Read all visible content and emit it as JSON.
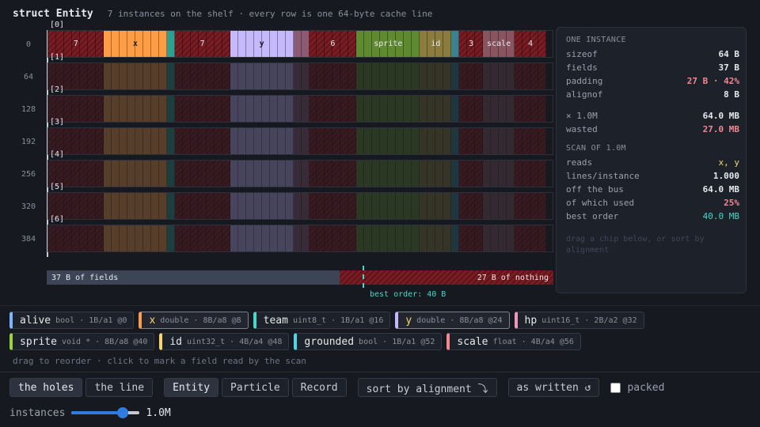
{
  "header": {
    "title": "struct Entity",
    "subtitle": "7 instances on the shelf · every row is one 64-byte cache line"
  },
  "fields": [
    {
      "id": "pad0",
      "hole": true,
      "label": "7",
      "bytes": 7
    },
    {
      "id": "x",
      "label": "x",
      "bytes": 8,
      "color": "#ff9d45"
    },
    {
      "id": "team",
      "label": "",
      "bytes": 1,
      "color": "#2fa08f"
    },
    {
      "id": "pad1",
      "hole": true,
      "label": "7",
      "bytes": 7
    },
    {
      "id": "y",
      "label": "y",
      "bytes": 8,
      "color": "#c5b8fb"
    },
    {
      "id": "hp",
      "label": "",
      "bytes": 2,
      "color": "#8c5a72"
    },
    {
      "id": "pad2",
      "hole": true,
      "label": "6",
      "bytes": 6
    },
    {
      "id": "sprite",
      "label": "sprite",
      "bytes": 8,
      "color": "#5f8a30"
    },
    {
      "id": "id",
      "label": "id",
      "bytes": 4,
      "color": "#8b7b3c"
    },
    {
      "id": "grounded",
      "label": "",
      "bytes": 1,
      "color": "#3c8190"
    },
    {
      "id": "pad3",
      "hole": true,
      "label": "3",
      "bytes": 3
    },
    {
      "id": "scale",
      "label": "scale",
      "bytes": 4,
      "color": "#87545f"
    },
    {
      "id": "pad4",
      "hole": true,
      "label": "4",
      "bytes": 4
    }
  ],
  "rows": [
    {
      "label": "[0]",
      "offset": "0",
      "active": true
    },
    {
      "label": "[1]",
      "offset": "64",
      "active": false
    },
    {
      "label": "[2]",
      "offset": "128",
      "active": false
    },
    {
      "label": "[3]",
      "offset": "192",
      "active": false
    },
    {
      "label": "[4]",
      "offset": "256",
      "active": false
    },
    {
      "label": "[5]",
      "offset": "320",
      "active": false
    },
    {
      "label": "[6]",
      "offset": "384",
      "active": false
    }
  ],
  "summary": {
    "fields_label": "37 B of fields",
    "nothing_label": "27 B of nothing",
    "fields_bytes": 37,
    "nothing_bytes": 27,
    "best_label": "best order: 40 B",
    "best_bytes": 40
  },
  "panel": {
    "instance_header": "ONE INSTANCE",
    "sizeof_key": "sizeof",
    "sizeof_val": "64 B",
    "fields_key": "fields",
    "fields_val": "37 B",
    "padding_key": "padding",
    "padding_val": "27 B · 42%",
    "alignof_key": "alignof",
    "alignof_val": "8 B",
    "times_key": "× 1.0M",
    "times_val": "64.0 MB",
    "wasted_key": "wasted",
    "wasted_val": "27.0 MB",
    "scan_header": "SCAN OF 1.0M",
    "reads_key": "reads",
    "reads_val": "x, y",
    "lines_key": "lines/instance",
    "lines_val": "1.000",
    "bus_key": "off the bus",
    "bus_val": "64.0 MB",
    "used_key": "of which used",
    "used_val": "25%",
    "best_key": "best order",
    "best_val": "40.0 MB",
    "hint": "drag a chip below, or sort by alignment"
  },
  "chips": [
    {
      "name": "alive",
      "meta": "bool · 1B/a1 @0",
      "color": "#7fb3ff",
      "read": false
    },
    {
      "name": "x",
      "meta": "double · 8B/a8 @8",
      "color": "#ff9d45",
      "read": true
    },
    {
      "name": "team",
      "meta": "uint8_t · 1B/a1 @16",
      "color": "#4ad6c4",
      "read": false
    },
    {
      "name": "y",
      "meta": "double · 8B/a8 @24",
      "color": "#c5b8fb",
      "read": true
    },
    {
      "name": "hp",
      "meta": "uint16_t · 2B/a2 @32",
      "color": "#f294c0",
      "read": false
    },
    {
      "name": "sprite",
      "meta": "void * · 8B/a8 @40",
      "color": "#9bd33c",
      "read": false
    },
    {
      "name": "id",
      "meta": "uint32_t · 4B/a4 @48",
      "color": "#f5d76e",
      "read": false
    },
    {
      "name": "grounded",
      "meta": "bool · 1B/a1 @52",
      "color": "#4ad6e4",
      "read": false
    },
    {
      "name": "scale",
      "meta": "float · 4B/a4 @56",
      "color": "#f2878f",
      "read": false
    }
  ],
  "hint": "drag to reorder · click to mark a field read by the scan",
  "controls": {
    "view_holes": "the holes",
    "view_line": "the line",
    "struct_entity": "Entity",
    "struct_particle": "Particle",
    "struct_record": "Record",
    "sort": "sort by alignment ⤵",
    "reset": "as written ↺",
    "packed": "packed"
  },
  "instances": {
    "label": "instances",
    "value": "1.0M",
    "fraction": 0.75
  }
}
